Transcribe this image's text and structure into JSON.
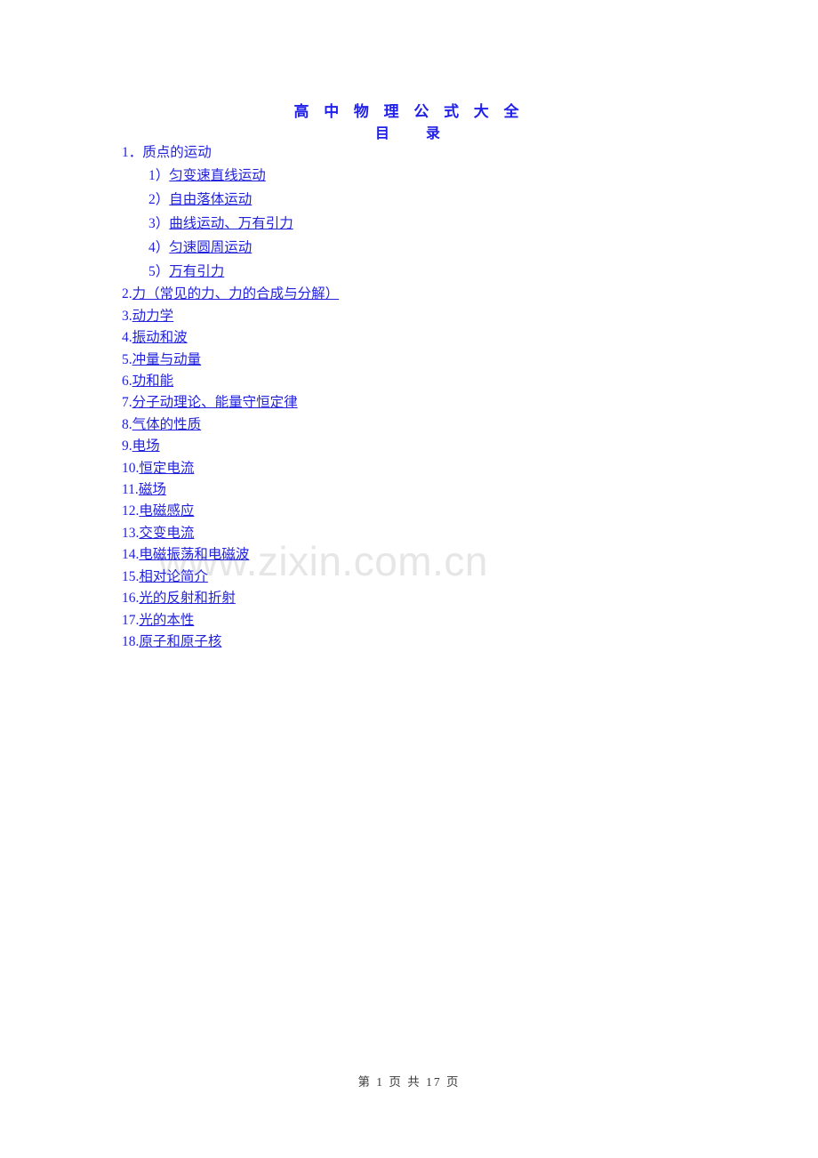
{
  "document": {
    "title": "高 中 物 理 公 式 大 全",
    "subtitle": "目　　录",
    "text_color": "#2222dd",
    "title_color": "#2020e8"
  },
  "watermark": {
    "text": "www.zixin.com.cn",
    "color": "#e6e6e6"
  },
  "toc": {
    "entries": [
      {
        "level": 1,
        "num": "1．",
        "label": "质点的运动",
        "underlined": false
      },
      {
        "level": 2,
        "num": "1）",
        "label": "匀变速直线运动",
        "underlined": true
      },
      {
        "level": 2,
        "num": "2）",
        "label": "自由落体运动",
        "underlined": true
      },
      {
        "level": 2,
        "num": "3）",
        "label": "曲线运动、万有引力",
        "underlined": true
      },
      {
        "level": 2,
        "num": "4）",
        "label": "匀速圆周运动",
        "underlined": true
      },
      {
        "level": 2,
        "num": "5）",
        "label": "万有引力",
        "underlined": true
      },
      {
        "level": 1,
        "num": "2.",
        "label": "力（常见的力、力的合成与分解）",
        "underlined": true
      },
      {
        "level": 1,
        "num": "3.",
        "label": "动力学",
        "underlined": true
      },
      {
        "level": 1,
        "num": "4.",
        "label": "振动和波",
        "underlined": true
      },
      {
        "level": 1,
        "num": "5.",
        "label": "冲量与动量",
        "underlined": true
      },
      {
        "level": 1,
        "num": "6.",
        "label": "功和能",
        "underlined": true
      },
      {
        "level": 1,
        "num": "7.",
        "label": "分子动理论、能量守恒定律",
        "underlined": true
      },
      {
        "level": 1,
        "num": "8.",
        "label": "气体的性质",
        "underlined": true
      },
      {
        "level": 1,
        "num": "9.",
        "label": "电场",
        "underlined": true
      },
      {
        "level": 1,
        "num": "10.",
        "label": "恒定电流",
        "underlined": true
      },
      {
        "level": 1,
        "num": "11.",
        "label": "磁场",
        "underlined": true
      },
      {
        "level": 1,
        "num": "12.",
        "label": "电磁感应",
        "underlined": true
      },
      {
        "level": 1,
        "num": "13.",
        "label": "交变电流",
        "underlined": true
      },
      {
        "level": 1,
        "num": "14.",
        "label": "电磁振荡和电磁波",
        "underlined": true
      },
      {
        "level": 1,
        "num": "15.",
        "label": "相对论简介",
        "underlined": true
      },
      {
        "level": 1,
        "num": "16.",
        "label": "光的反射和折射",
        "underlined": true
      },
      {
        "level": 1,
        "num": "17.",
        "label": "光的本性",
        "underlined": true
      },
      {
        "level": 1,
        "num": "18.",
        "label": "原子和原子核",
        "underlined": true
      }
    ]
  },
  "footer": {
    "text": "第 1 页 共 17 页"
  }
}
